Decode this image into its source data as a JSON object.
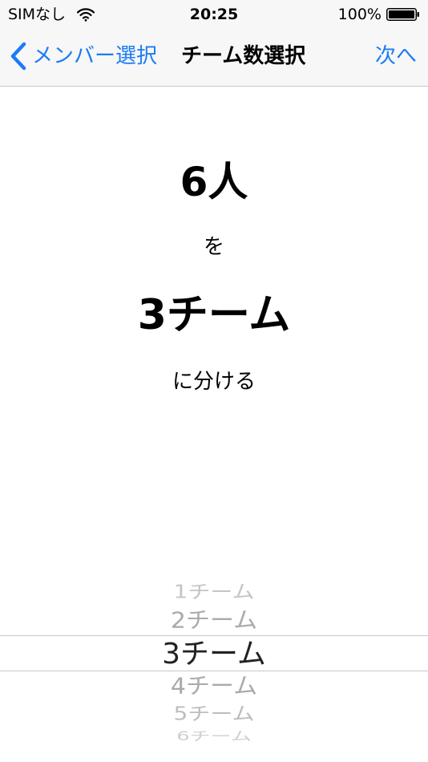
{
  "status_bar": {
    "carrier": "SIMなし",
    "time": "20:25",
    "battery": "100%"
  },
  "nav": {
    "back_label": "メンバー選択",
    "title": "チーム数選択",
    "next_label": "次へ"
  },
  "summary": {
    "people": "6人",
    "particle": "を",
    "teams": "3チーム",
    "suffix": "に分ける"
  },
  "picker": {
    "items": [
      "1チーム",
      "2チーム",
      "3チーム",
      "4チーム",
      "5チーム",
      "6チーム"
    ],
    "selected": "3チーム"
  },
  "colors": {
    "accent": "#1a7cf5",
    "bar_background": "#f7f7f7",
    "separator": "#c8c7cc"
  }
}
